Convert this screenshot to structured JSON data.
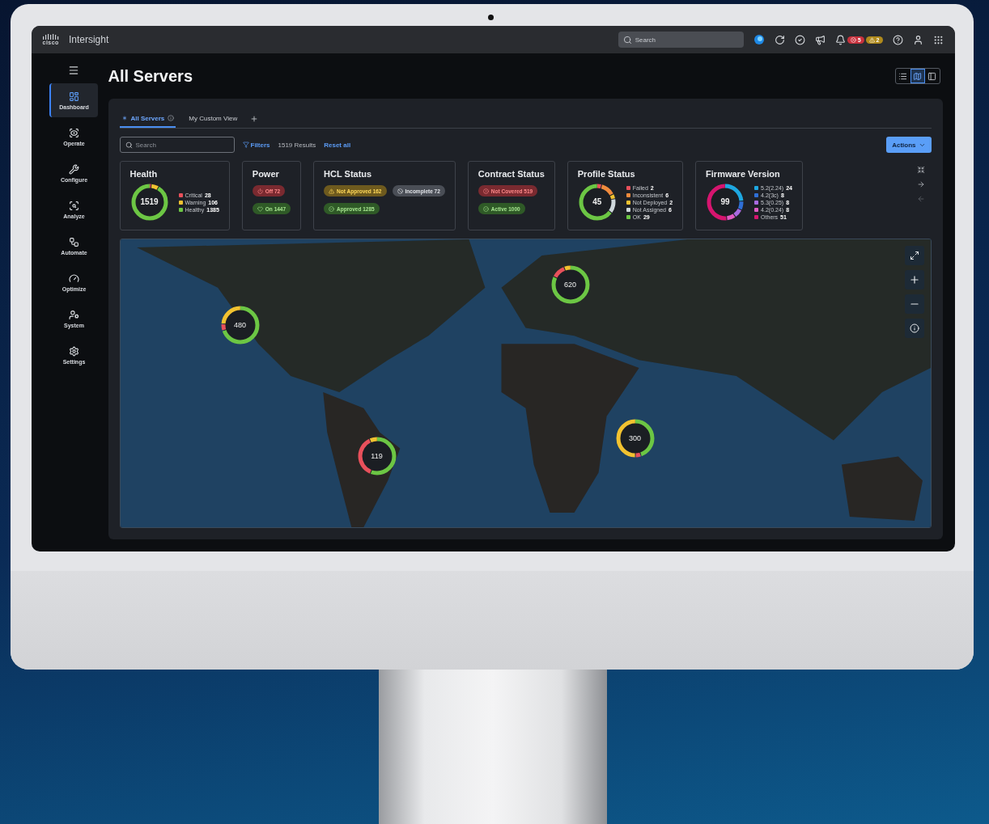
{
  "app": {
    "logo_text": "cisco",
    "name": "Intersight",
    "search": {
      "placeholder": "Search"
    },
    "alerts": [
      {
        "kind": "critical",
        "count": "5"
      },
      {
        "kind": "warning",
        "count": "2"
      }
    ]
  },
  "sidebar": {
    "items": [
      {
        "label": "Dashboard",
        "selected": true
      },
      {
        "label": "Operate",
        "selected": false
      },
      {
        "label": "Configure",
        "selected": false
      },
      {
        "label": "Analyze",
        "selected": false
      },
      {
        "label": "Automate",
        "selected": false
      },
      {
        "label": "Optimize",
        "selected": false
      },
      {
        "label": "System",
        "selected": false
      },
      {
        "label": "Settings",
        "selected": false
      }
    ]
  },
  "page": {
    "title": "All Servers",
    "view_toggles": [
      {
        "selected": false
      },
      {
        "selected": true
      },
      {
        "selected": false
      }
    ]
  },
  "tabs": [
    {
      "label": "All Servers",
      "selected": true
    },
    {
      "label": "My Custom View",
      "selected": false
    }
  ],
  "toolbar": {
    "search": {
      "placeholder": "Search"
    },
    "filters": "Filters",
    "results": "1519 Results",
    "reset": "Reset all",
    "actions": "Actions"
  },
  "cards": [
    {
      "kind": "donut",
      "title": "Health",
      "total": "1519",
      "legend": [
        {
          "label": "Critical",
          "count": "28",
          "color": "#e8505b",
          "level": 0.018
        },
        {
          "label": "Warning",
          "count": "106",
          "color": "#f2c230",
          "level": 0.07
        },
        {
          "label": "Healthy",
          "count": "1385",
          "color": "#6cc644",
          "level": 0.912
        }
      ]
    },
    {
      "kind": "badges",
      "title": "Power",
      "rows": [
        [
          {
            "kind": "off",
            "text": "Off 72"
          }
        ],
        [
          {
            "kind": "on",
            "text": "On 1447"
          }
        ]
      ]
    },
    {
      "kind": "badges",
      "title": "HCL Status",
      "rows": [
        [
          {
            "kind": "warning",
            "text": "Not Approved 162"
          },
          {
            "kind": "blocked",
            "text": "Incomplete 72"
          }
        ],
        [
          {
            "kind": "success",
            "text": "Approved 1285"
          }
        ]
      ]
    },
    {
      "kind": "badges",
      "title": "Contract Status",
      "rows": [
        [
          {
            "kind": "error",
            "text": "Not Covered 519"
          }
        ],
        [
          {
            "kind": "success",
            "text": "Active 1000"
          }
        ]
      ]
    },
    {
      "kind": "donut",
      "title": "Profile Status",
      "total": "45",
      "legend": [
        {
          "label": "Failed",
          "count": "2",
          "color": "#e8505b",
          "level": 0.044
        },
        {
          "label": "Inconsistent",
          "count": "6",
          "color": "#f08a3c",
          "level": 0.133
        },
        {
          "label": "Not Deployed",
          "count": "2",
          "color": "#f2c230",
          "level": 0.044
        },
        {
          "label": "Not Assigned",
          "count": "6",
          "color": "#cfd8dc",
          "level": 0.133
        },
        {
          "label": "OK",
          "count": "29",
          "color": "#6cc644",
          "level": 0.646
        }
      ]
    },
    {
      "kind": "donut",
      "title": "Firmware Version",
      "total": "99",
      "legend": [
        {
          "label": "5.2(2.24)",
          "count": "24",
          "color": "#1ea7e0",
          "level": 0.242
        },
        {
          "label": "4.2(3c)",
          "count": "8",
          "color": "#2f6fd6",
          "level": 0.081
        },
        {
          "label": "5.3(0.25)",
          "count": "8",
          "color": "#a86be0",
          "level": 0.081
        },
        {
          "label": "4.2(0.24)",
          "count": "8",
          "color": "#e05cc4",
          "level": 0.081
        },
        {
          "label": "Others",
          "count": "51",
          "color": "#d6156f",
          "level": 0.515
        }
      ]
    }
  ],
  "map": {
    "clusters": [
      {
        "count": "480",
        "segments": [
          {
            "color": "#6cc644",
            "level": 0.7
          },
          {
            "color": "#e8505b",
            "level": 0.06
          },
          {
            "color": "#f2c230",
            "level": 0.24
          }
        ]
      },
      {
        "count": "620",
        "segments": [
          {
            "color": "#6cc644",
            "level": 0.82
          },
          {
            "color": "#e8505b",
            "level": 0.12
          },
          {
            "color": "#f2c230",
            "level": 0.06
          }
        ]
      },
      {
        "count": "119",
        "segments": [
          {
            "color": "#6cc644",
            "level": 0.56
          },
          {
            "color": "#e8505b",
            "level": 0.37
          },
          {
            "color": "#f2c230",
            "level": 0.07
          }
        ]
      },
      {
        "count": "300",
        "segments": [
          {
            "color": "#6cc644",
            "level": 0.45
          },
          {
            "color": "#e8505b",
            "level": 0.05
          },
          {
            "color": "#f2c230",
            "level": 0.5
          }
        ]
      }
    ]
  }
}
